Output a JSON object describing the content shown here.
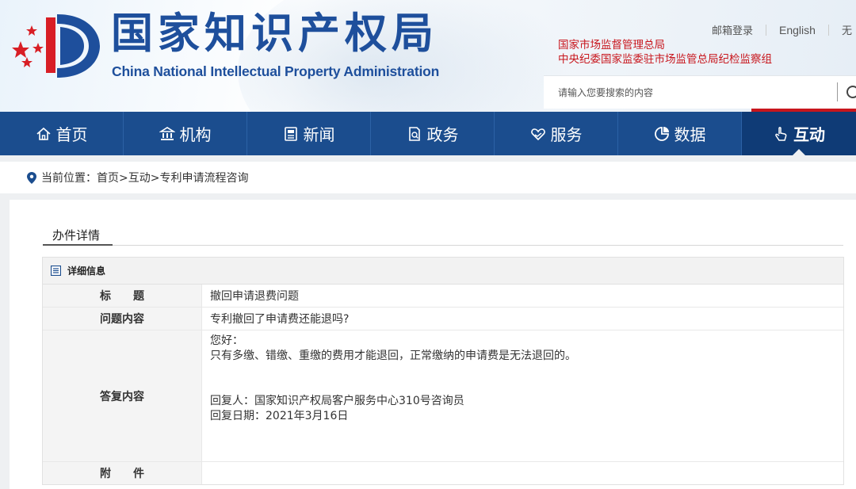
{
  "header": {
    "logo_cn": "国家知识产权局",
    "logo_en": "China National Intellectual Property Administration",
    "ministry_line1": "国家市场监督管理总局",
    "ministry_line2": "中央纪委国家监委驻市场监管总局纪检监察组",
    "links": [
      "邮箱登录",
      "English",
      "无"
    ],
    "search_placeholder": "请输入您要搜索的内容"
  },
  "nav": {
    "items": [
      {
        "label": "首页",
        "icon": "home-icon"
      },
      {
        "label": "机构",
        "icon": "institution-icon"
      },
      {
        "label": "新闻",
        "icon": "news-icon"
      },
      {
        "label": "政务",
        "icon": "government-icon"
      },
      {
        "label": "服务",
        "icon": "heart-hands-icon"
      },
      {
        "label": "数据",
        "icon": "pie-chart-icon"
      },
      {
        "label": "互动",
        "icon": "hand-pointer-icon"
      }
    ],
    "active": "互动"
  },
  "breadcrumb": {
    "text": "当前位置：首页>互动>专利申请流程咨询"
  },
  "main": {
    "tab_label": "办件详情",
    "detail_header": "详细信息",
    "rows": {
      "title_label": "标　　题",
      "title_value": "撤回申请退费问题",
      "question_label": "问题内容",
      "question_value": "专利撤回了申请费还能退吗?",
      "answer_label": "答复内容",
      "answer_greeting": "您好：",
      "answer_body": "只有多缴、错缴、重缴的费用才能退回，正常缴纳的申请费是无法退回的。",
      "answer_person": "回复人：国家知识产权局客户服务中心310号咨询员",
      "answer_date": "回复日期：2021年3月16日",
      "attachment_label": "附　　件"
    }
  },
  "colors": {
    "brand_blue": "#1e4f9c",
    "nav_blue": "#1b4d8e",
    "nav_active": "#0f3b76",
    "ministry_red": "#c8161d"
  }
}
